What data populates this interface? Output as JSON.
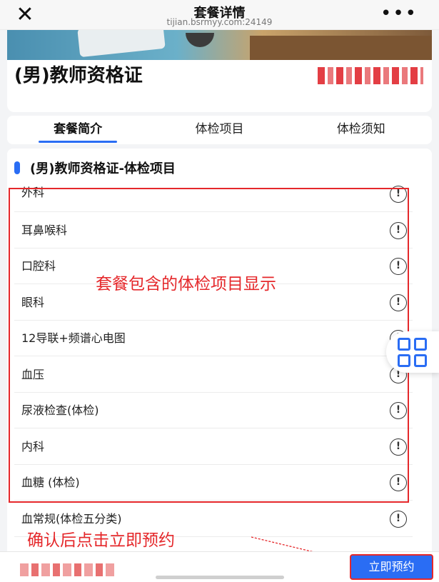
{
  "topbar": {
    "close_icon": "close-icon",
    "title": "套餐详情",
    "url": "tijian.bsrmyy.com:24149",
    "more_icon": "more-icon"
  },
  "package": {
    "title": "(男)教师资格证"
  },
  "tabs": [
    {
      "label": "套餐简介",
      "active": true
    },
    {
      "label": "体检项目",
      "active": false
    },
    {
      "label": "体检须知",
      "active": false
    }
  ],
  "section": {
    "title": "(男)教师资格证-体检项目"
  },
  "items": [
    {
      "label": "外科"
    },
    {
      "label": "耳鼻喉科"
    },
    {
      "label": "口腔科"
    },
    {
      "label": "眼科"
    },
    {
      "label": "12导联+频谱心电图"
    },
    {
      "label": "血压"
    },
    {
      "label": "尿液检查(体检)"
    },
    {
      "label": "内科"
    },
    {
      "label": "血糖 (体检)"
    },
    {
      "label": "血常规(体检五分类)"
    }
  ],
  "annotations": {
    "center_note": "套餐包含的体检项目显示",
    "bottom_note": "确认后点击立即预约"
  },
  "bottom": {
    "book_label": "立即预约"
  },
  "colors": {
    "accent": "#2a6df4",
    "annotation": "#e5282b"
  }
}
